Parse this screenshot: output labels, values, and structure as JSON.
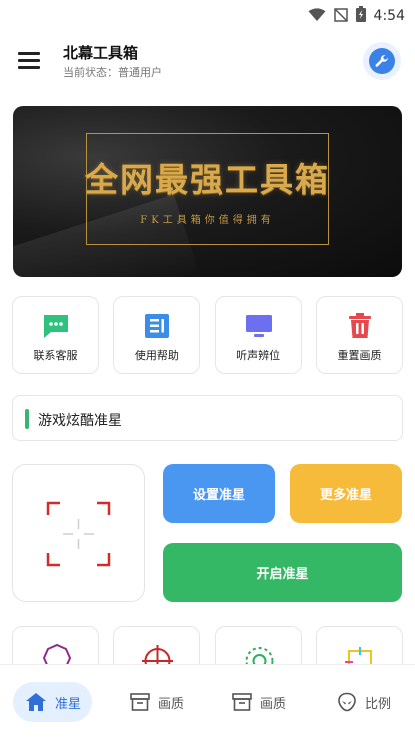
{
  "status_bar": {
    "time": "4:54"
  },
  "app_bar": {
    "title": "北幕工具箱",
    "status_line": "当前状态：普通用户"
  },
  "banner": {
    "headline": "全网最强工具箱",
    "tagline": "FK工具箱你值得拥有"
  },
  "features": [
    {
      "label": "联系客服",
      "icon": "chat-icon",
      "color": "#2ec27e"
    },
    {
      "label": "使用帮助",
      "icon": "document-icon",
      "color": "#3b8de8"
    },
    {
      "label": "听声辨位",
      "icon": "monitor-icon",
      "color": "#6c6ff0"
    },
    {
      "label": "重置画质",
      "icon": "trash-icon",
      "color": "#e5484d"
    }
  ],
  "notice": {
    "text": "游戏炫酷准星"
  },
  "actions": {
    "set_crosshair": "设置准星",
    "more_crosshair": "更多准星",
    "open_crosshair": "开启准星"
  },
  "crosshair_color": "#d42a2a",
  "bottom_nav": [
    {
      "label": "准星",
      "icon": "home-icon",
      "active": true
    },
    {
      "label": "画质",
      "icon": "archive-icon",
      "active": false
    },
    {
      "label": "画质",
      "icon": "archive-icon",
      "active": false
    },
    {
      "label": "比例",
      "icon": "alien-icon",
      "active": false
    }
  ]
}
